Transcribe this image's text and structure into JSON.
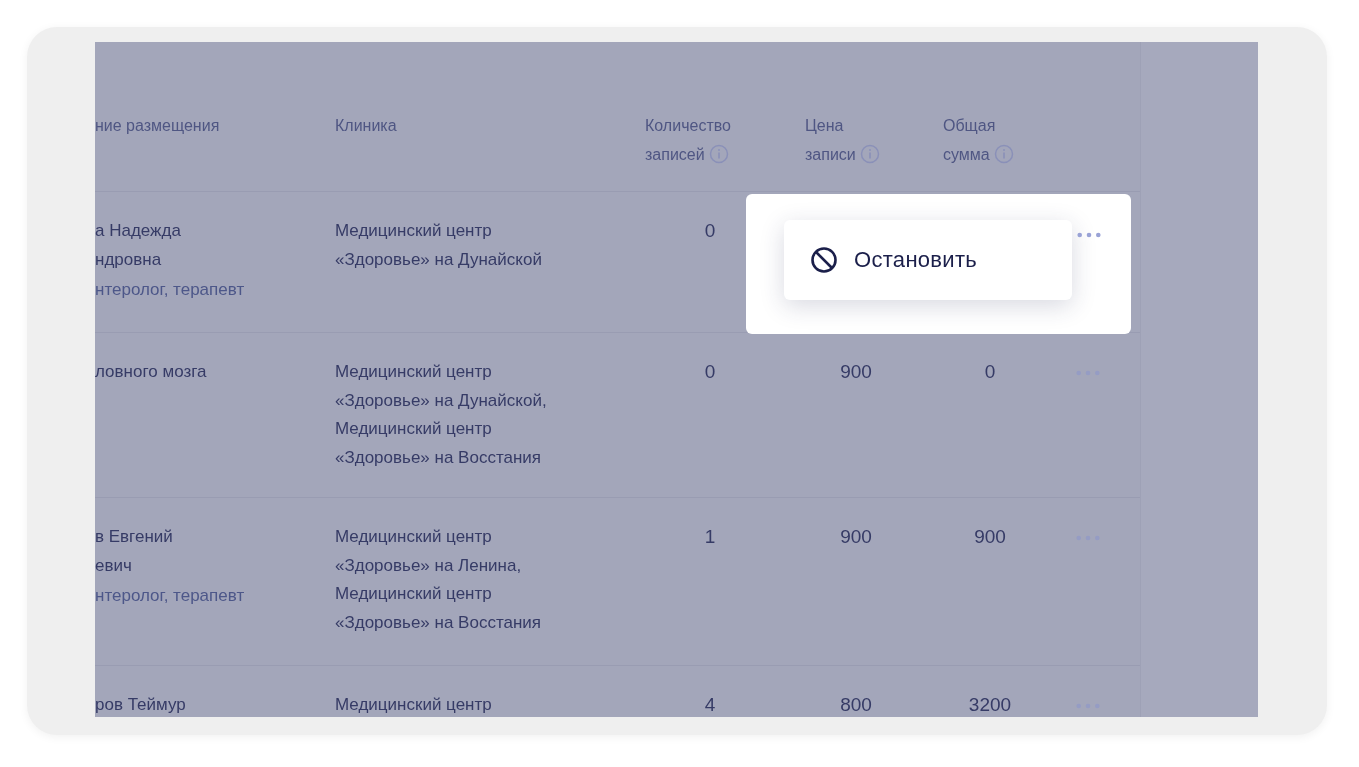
{
  "table": {
    "columns": [
      {
        "label": "ние размещения",
        "info": false
      },
      {
        "label": "Клиника",
        "info": false
      },
      {
        "label": "Количество записей",
        "info": true
      },
      {
        "label": "Цена записи",
        "info": true
      },
      {
        "label": "Общая сумма",
        "info": true
      }
    ],
    "rows": [
      {
        "name_lines": [
          "а Надежда",
          "ндровна"
        ],
        "specialty": "нтеролог, терапевт",
        "clinic_lines": [
          "Медицинский центр",
          "«Здоровье» на Дунайской"
        ],
        "count": "0",
        "menu_open": true
      },
      {
        "name_lines": [
          "ловного мозга"
        ],
        "clinic_lines": [
          "Медицинский центр",
          "«Здоровье» на Дунайской,",
          "Медицинский центр",
          "«Здоровье» на Восстания"
        ],
        "count": "0",
        "price": "900",
        "total": "0",
        "menu_open": false
      },
      {
        "name_lines": [
          "в Евгений",
          "евич"
        ],
        "specialty": "нтеролог, терапевт",
        "clinic_lines": [
          "Медицинский центр",
          "«Здоровье» на Ленина,",
          "Медицинский центр",
          "«Здоровье» на Восстания"
        ],
        "count": "1",
        "price": "900",
        "total": "900",
        "menu_open": false
      },
      {
        "name_lines": [
          "ров Теймур"
        ],
        "clinic_lines": [
          "Медицинский центр"
        ],
        "count": "4",
        "price": "800",
        "total": "3200",
        "menu_open": false
      }
    ]
  },
  "menu": {
    "items": [
      {
        "label": "Остановить"
      }
    ]
  }
}
